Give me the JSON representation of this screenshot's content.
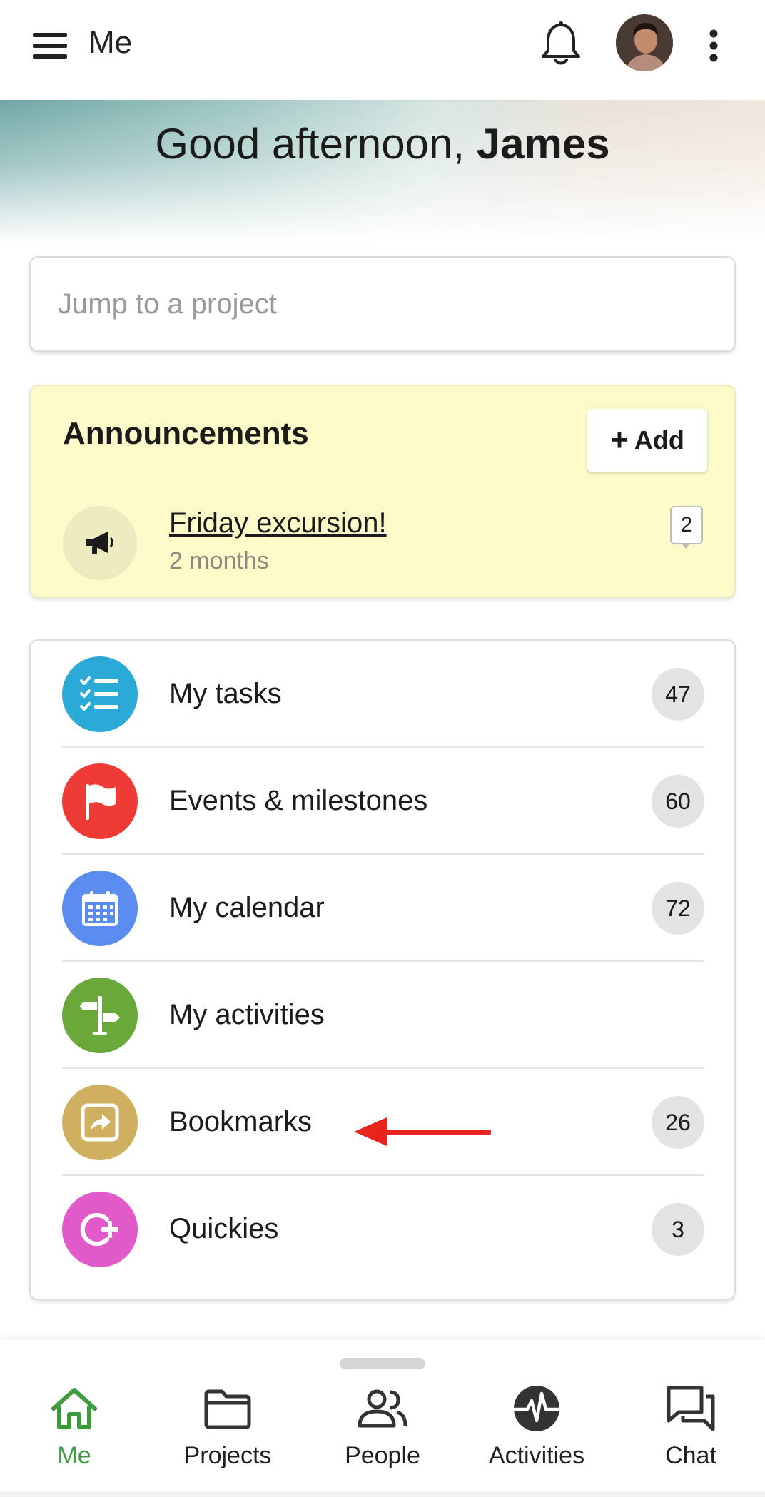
{
  "appbar": {
    "title": "Me",
    "icons": {
      "menu": "hamburger-menu-icon",
      "notifications": "bell-icon",
      "avatar": "user-avatar",
      "more": "more-vertical-icon"
    }
  },
  "hero": {
    "greeting_prefix": "Good afternoon, ",
    "user_name": "James"
  },
  "search": {
    "placeholder": "Jump to a project",
    "value": ""
  },
  "announcements": {
    "title": "Announcements",
    "add_label": "Add",
    "items": [
      {
        "title": "Friday excursion!",
        "meta": "2 months",
        "comment_count": "2",
        "icon": "megaphone-icon"
      }
    ]
  },
  "menu": {
    "items": [
      {
        "label": "My tasks",
        "count": "47",
        "icon": "task-list-icon",
        "color": "#2baad8"
      },
      {
        "label": "Events & milestones",
        "count": "60",
        "icon": "flag-icon",
        "color": "#ef3b36"
      },
      {
        "label": "My calendar",
        "count": "72",
        "icon": "calendar-icon",
        "color": "#5a8def"
      },
      {
        "label": "My activities",
        "count": "",
        "icon": "signpost-icon",
        "color": "#69a93a"
      },
      {
        "label": "Bookmarks",
        "count": "26",
        "icon": "bookmark-share-icon",
        "color": "#cfb060"
      },
      {
        "label": "Quickies",
        "count": "3",
        "icon": "quickie-icon",
        "color": "#e05bc8"
      }
    ]
  },
  "annotation": {
    "arrow_color": "#e8251c",
    "target": "Bookmarks"
  },
  "bottom_nav": {
    "active_color": "#3f9a3f",
    "items": [
      {
        "label": "Me",
        "icon": "home-icon",
        "active": true
      },
      {
        "label": "Projects",
        "icon": "folder-icon",
        "active": false
      },
      {
        "label": "People",
        "icon": "people-icon",
        "active": false
      },
      {
        "label": "Activities",
        "icon": "activity-pulse-icon",
        "active": false
      },
      {
        "label": "Chat",
        "icon": "chat-icon",
        "active": false
      }
    ]
  }
}
